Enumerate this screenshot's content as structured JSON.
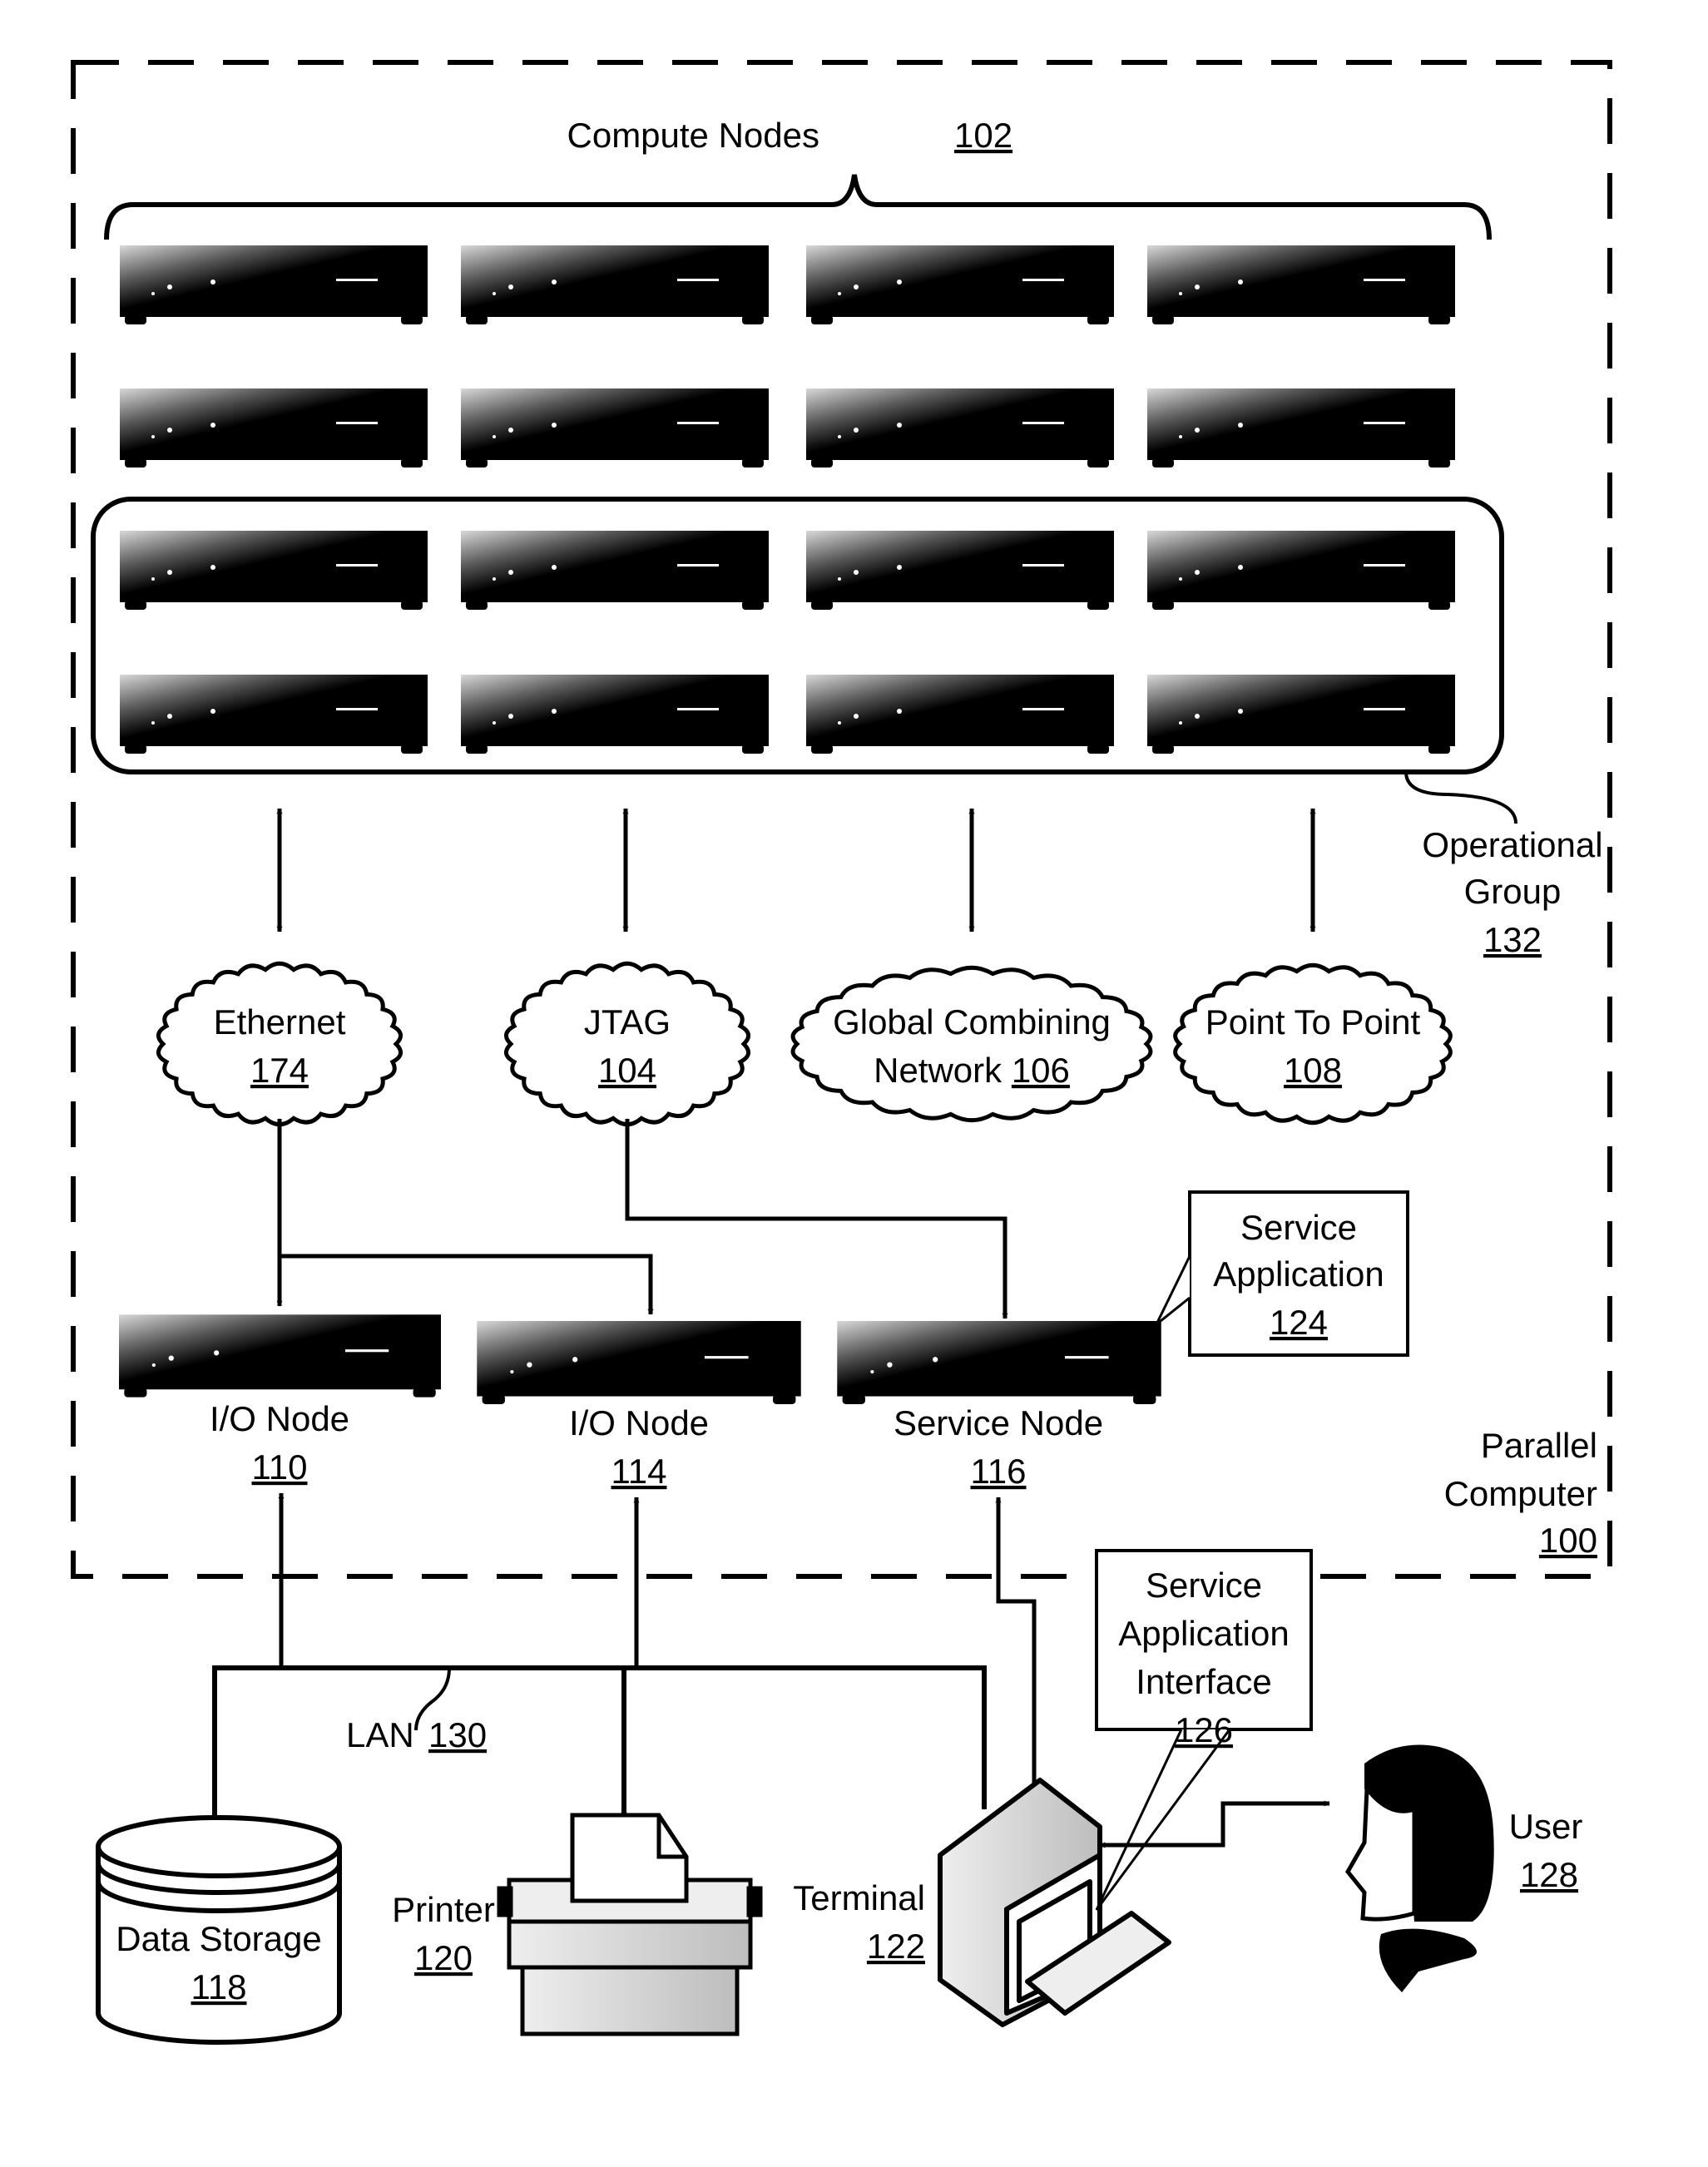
{
  "figure": {
    "parallel_computer": {
      "label_line1": "Parallel",
      "label_line2": "Computer",
      "ref": "100"
    },
    "compute_nodes": {
      "label": "Compute Nodes",
      "ref": "102",
      "rows": 4,
      "cols": 4
    },
    "operational_group": {
      "label_line1": "Operational",
      "label_line2": "Group",
      "ref": "132"
    },
    "networks": [
      {
        "id": "ethernet",
        "line1": "Ethernet",
        "line2": "",
        "ref": "174"
      },
      {
        "id": "jtag",
        "line1": "JTAG",
        "line2": "",
        "ref": "104"
      },
      {
        "id": "global-combining-network",
        "line1": "Global Combining",
        "line2": "Network",
        "ref": "106"
      },
      {
        "id": "point-to-point",
        "line1": "Point To Point",
        "line2": "",
        "ref": "108"
      }
    ],
    "io_nodes": [
      {
        "label": "I/O Node",
        "ref": "110"
      },
      {
        "label": "I/O Node",
        "ref": "114"
      }
    ],
    "service_node": {
      "label": "Service Node",
      "ref": "116"
    },
    "service_application": {
      "line1": "Service",
      "line2": "Application",
      "ref": "124"
    },
    "service_application_interface": {
      "line1": "Service",
      "line2": "Application",
      "line3": "Interface",
      "ref": "126"
    },
    "lan": {
      "label": "LAN",
      "ref": "130"
    },
    "data_storage": {
      "label": "Data Storage",
      "ref": "118"
    },
    "printer": {
      "label": "Printer",
      "ref": "120"
    },
    "terminal": {
      "label": "Terminal",
      "ref": "122"
    },
    "user": {
      "label": "User",
      "ref": "128"
    }
  }
}
